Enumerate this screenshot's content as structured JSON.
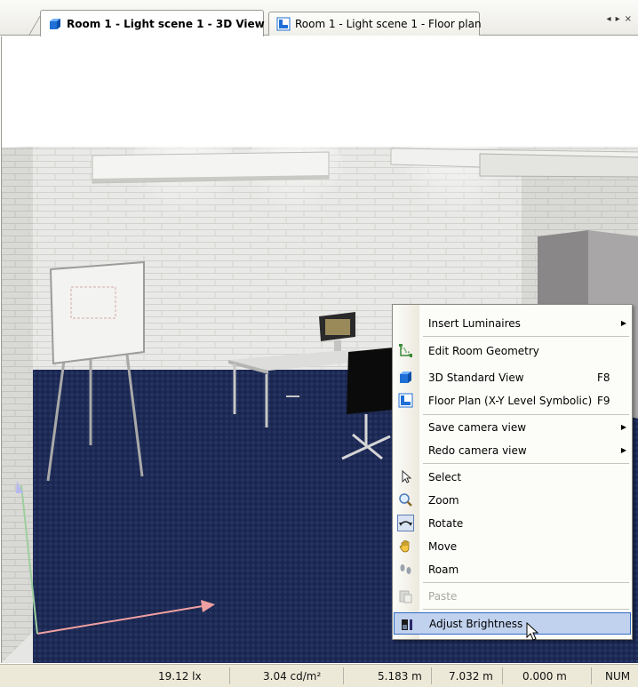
{
  "tabs": [
    {
      "label": "Room 1 - Light scene 1 - 3D View",
      "active": true,
      "icon": "3d-view-icon"
    },
    {
      "label": "Room 1 - Light scene 1 - Floor plan",
      "active": false,
      "icon": "floor-plan-icon"
    }
  ],
  "tab_nav": {
    "prev": "◂",
    "next": "▸",
    "close": "×"
  },
  "context_menu": {
    "items": [
      {
        "label": "Insert Luminaires",
        "submenu": true
      },
      {
        "label": "Edit Room Geometry",
        "icon": "room-geometry-icon"
      },
      {
        "label": "3D Standard View",
        "shortcut": "F8",
        "icon": "3d-view-icon"
      },
      {
        "label": "Floor Plan (X-Y Level Symbolic)",
        "shortcut": "F9",
        "icon": "floor-plan-icon"
      },
      {
        "label": "Save camera view",
        "submenu": true
      },
      {
        "label": "Redo camera view",
        "submenu": true
      },
      {
        "label": "Select",
        "icon": "cursor-icon"
      },
      {
        "label": "Zoom",
        "icon": "magnifier-icon"
      },
      {
        "label": "Rotate",
        "icon": "rotate-icon",
        "checked": true
      },
      {
        "label": "Move",
        "icon": "hand-icon"
      },
      {
        "label": "Roam",
        "icon": "footsteps-icon"
      },
      {
        "label": "Paste",
        "icon": "paste-icon",
        "disabled": true
      },
      {
        "label": "Adjust Brightness",
        "icon": "brightness-icon",
        "highlighted": true
      }
    ],
    "submenu_arrow": "▶"
  },
  "status_bar": {
    "illuminance": "19.12 lx",
    "luminance": "3.04 cd/m²",
    "x": "5.183 m",
    "y": "7.032 m",
    "z": "0.000 m",
    "num": "NUM"
  },
  "colors": {
    "carpet": "#1e2b55",
    "wall": "#e7e7e5",
    "menu_highlight": "#c1d2ee",
    "menu_highlight_border": "#316ac5"
  }
}
